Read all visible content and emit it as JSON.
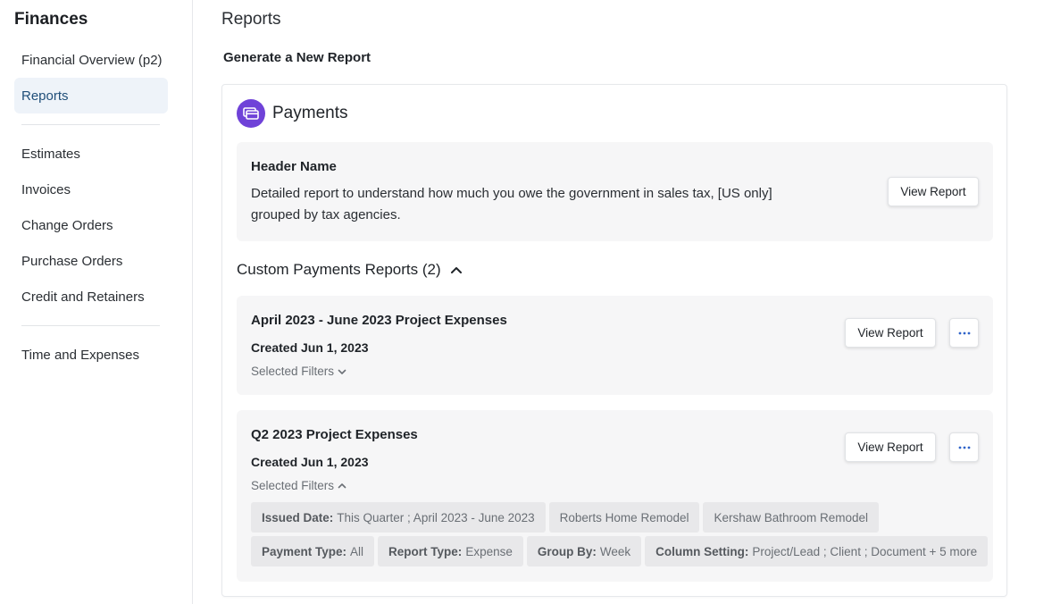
{
  "sidebar": {
    "title": "Finances",
    "items": [
      {
        "label": "Financial Overview (p2)"
      },
      {
        "label": "Reports"
      },
      {
        "label": "Estimates"
      },
      {
        "label": "Invoices"
      },
      {
        "label": "Change Orders"
      },
      {
        "label": "Purchase Orders"
      },
      {
        "label": "Credit and Retainers"
      },
      {
        "label": "Time and Expenses"
      }
    ]
  },
  "main": {
    "title": "Reports",
    "subtitle": "Generate a New Report",
    "card": {
      "icon": "payments-card-icon",
      "accent": "#6f42d8",
      "title": "Payments",
      "header_report": {
        "title": "Header Name",
        "description": "Detailed report to understand how much you owe the government in sales tax, [US only] grouped by tax agencies.",
        "button": "View Report"
      },
      "custom": {
        "heading": "Custom Payments Reports (2)",
        "reports": [
          {
            "title": "April 2023 - June 2023 Project Expenses",
            "created": "Created Jun 1, 2023",
            "filters_label": "Selected Filters",
            "button": "View Report"
          },
          {
            "title": "Q2 2023 Project Expenses",
            "created": "Created Jun 1, 2023",
            "filters_label": "Selected Filters",
            "button": "View Report",
            "chips_row1": [
              {
                "key": "Issued Date:",
                "value": "This Quarter ; April 2023 - June 2023"
              },
              {
                "key": "",
                "value": "Roberts Home Remodel"
              },
              {
                "key": "",
                "value": "Kershaw Bathroom Remodel"
              }
            ],
            "chips_row2": [
              {
                "key": "Payment Type:",
                "value": "All"
              },
              {
                "key": "Report Type:",
                "value": "Expense"
              },
              {
                "key": "Group By:",
                "value": "Week"
              },
              {
                "key": "Column Setting:",
                "value": "Project/Lead ; Client ; Document + 5 more"
              }
            ]
          }
        ]
      }
    }
  }
}
